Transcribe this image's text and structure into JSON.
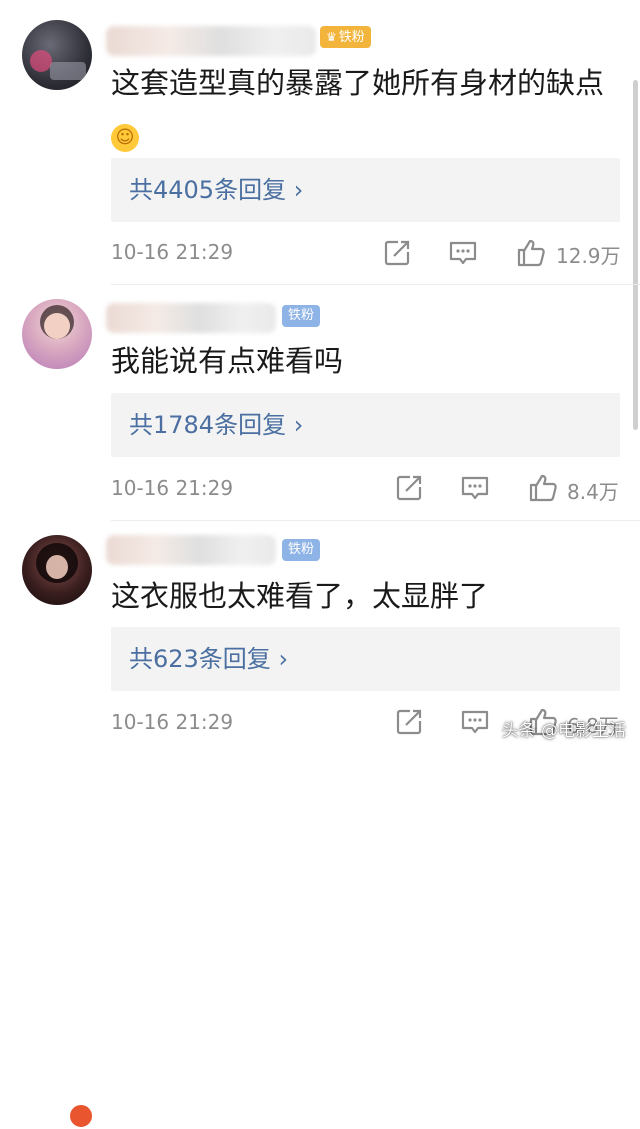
{
  "comments": [
    {
      "badge": "铁粉",
      "text": "这套造型真的暴露了她所有身材的缺点",
      "reply_label": "共4405条回复",
      "time": "10-16 21:29",
      "likes": "12.9万"
    },
    {
      "badge": "铁粉",
      "text": "我能说有点难看吗",
      "reply_label": "共1784条回复",
      "time": "10-16 21:29",
      "likes": "8.4万"
    },
    {
      "badge": "铁粉",
      "text": "这衣服也太难看了，太显胖了",
      "reply_label": "共623条回复",
      "time": "10-16 21:29",
      "likes": "6.8万"
    }
  ],
  "icons": {
    "chevron": "›",
    "share": "share-icon",
    "comment": "comment-icon",
    "like": "thumbs-up-icon"
  },
  "watermark": "头条 @电影生活",
  "colors": {
    "link": "#4a6fa0",
    "meta": "#8c8c8c",
    "reply_bg": "#f3f3f3",
    "badge_gold": "#f2b43a",
    "badge_blue": "#8eb3e6"
  }
}
